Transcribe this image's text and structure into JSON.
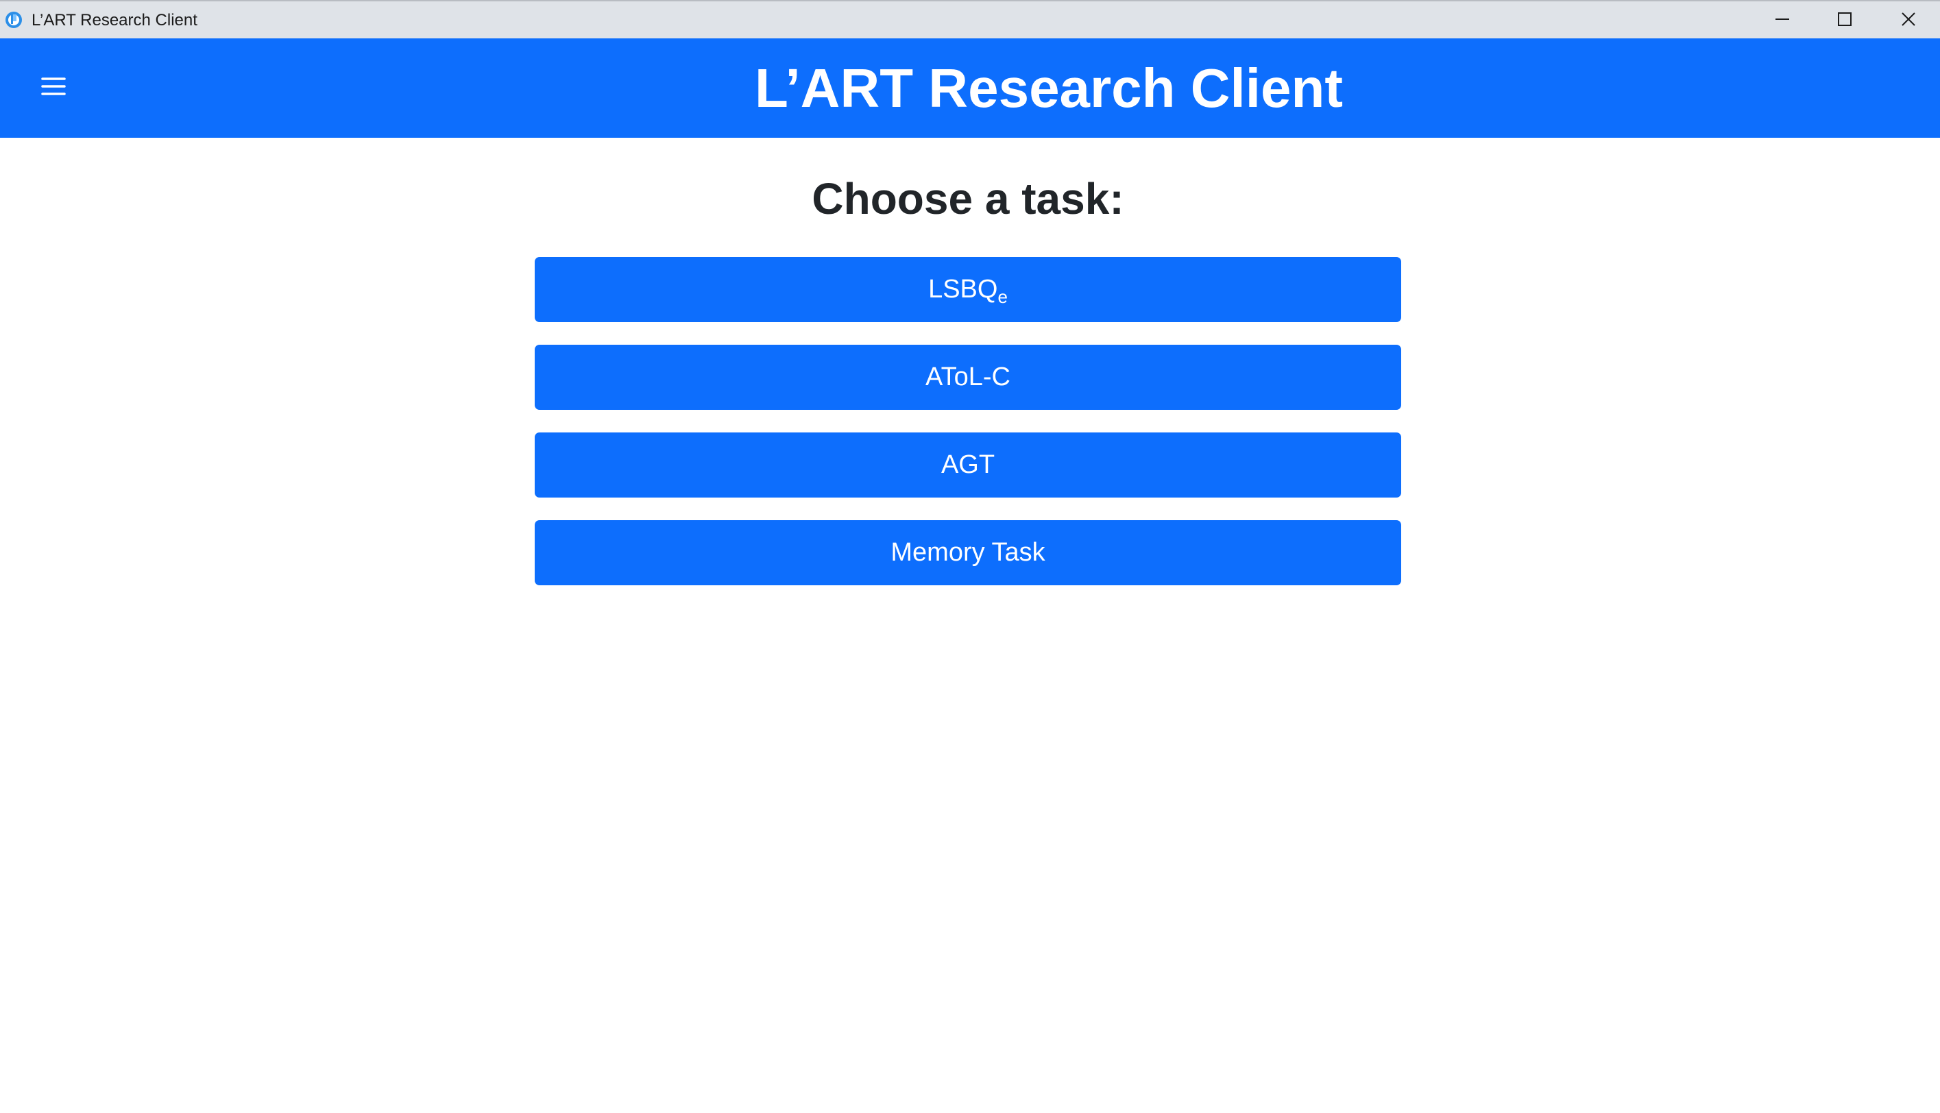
{
  "window": {
    "title": "L’ART Research Client",
    "controls": {
      "minimize_icon": "minimize-icon",
      "maximize_icon": "maximize-icon",
      "close_icon": "close-icon"
    }
  },
  "navbar": {
    "title": "L’ART Research Client",
    "menu_icon": "hamburger-menu-icon",
    "color": "#0d6efd"
  },
  "main": {
    "heading": "Choose a task:",
    "tasks": [
      {
        "label": "LSBQ",
        "subscript": "e"
      },
      {
        "label": "AToL-C"
      },
      {
        "label": "AGT"
      },
      {
        "label": "Memory Task"
      }
    ]
  },
  "colors": {
    "accent": "#0d6efd",
    "titlebar": "#dfe3e8",
    "heading_text": "#212529"
  }
}
